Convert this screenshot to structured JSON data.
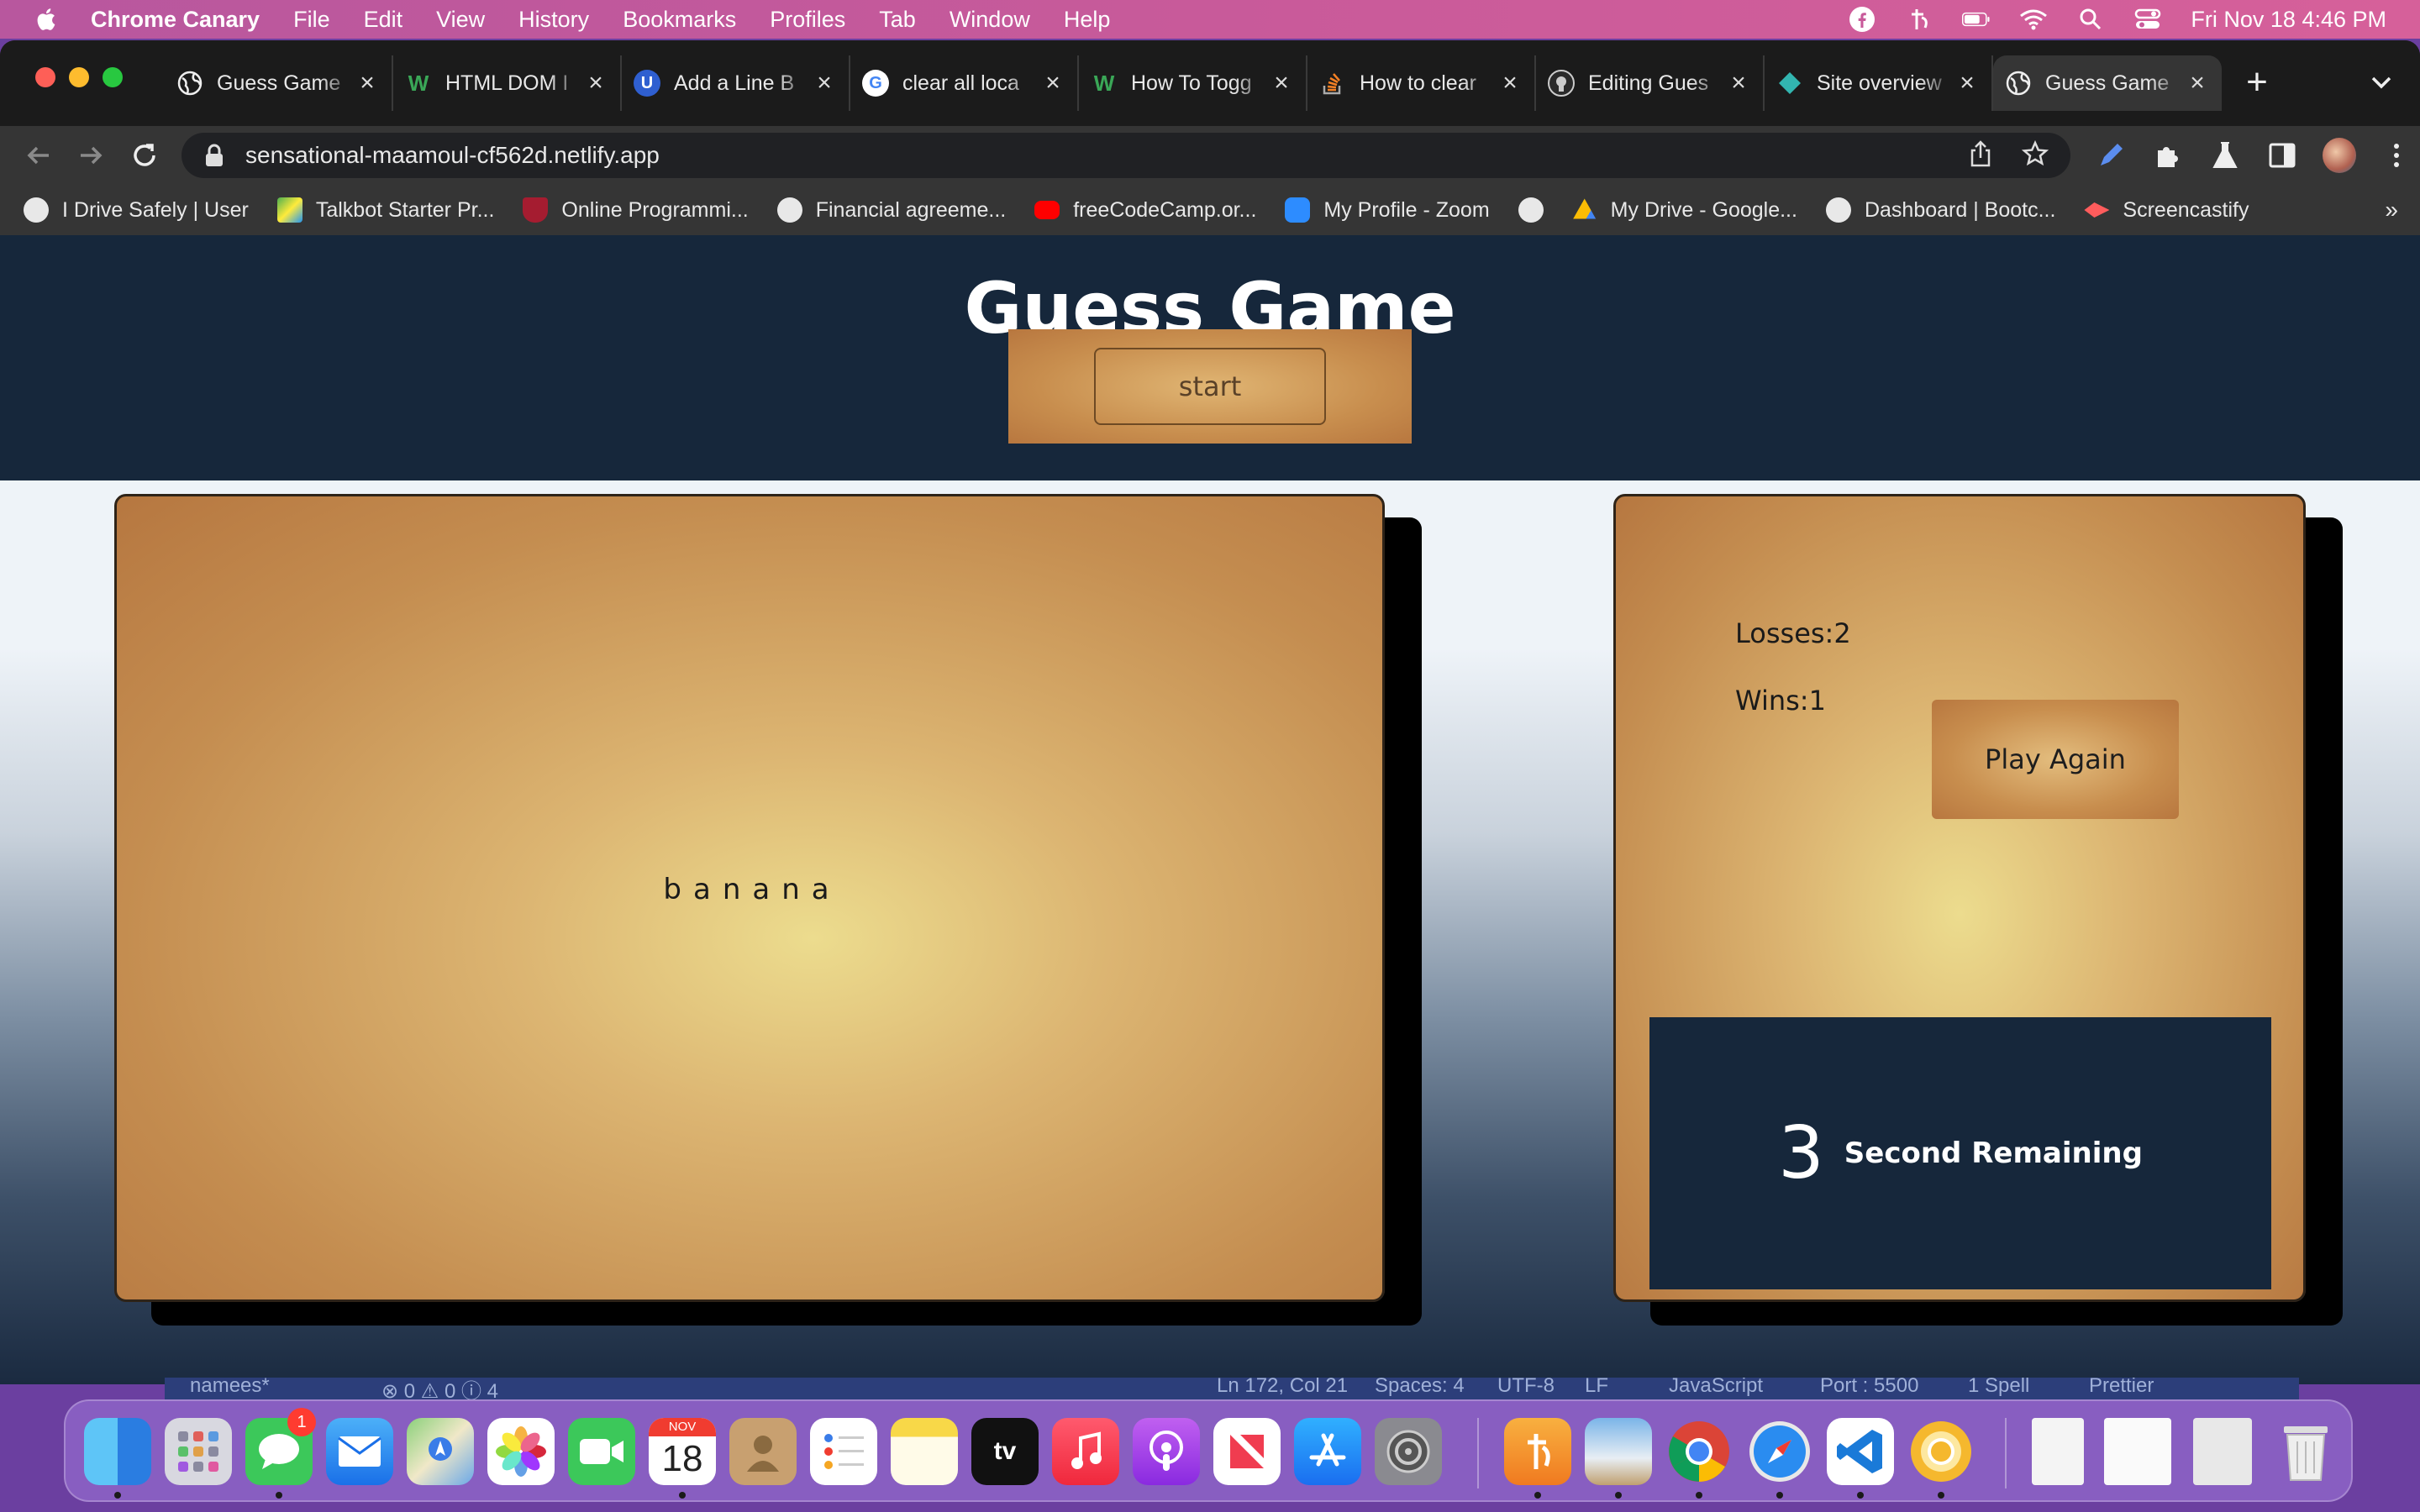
{
  "menubar": {
    "app_name": "Chrome Canary",
    "items": [
      "File",
      "Edit",
      "View",
      "History",
      "Bookmarks",
      "Profiles",
      "Tab",
      "Window",
      "Help"
    ],
    "clock": "Fri Nov 18  4:46 PM"
  },
  "browser": {
    "tabs": [
      {
        "title": "Guess Game",
        "icon": "globe-icon",
        "active": false
      },
      {
        "title": "HTML DOM I",
        "icon": "w3schools-icon",
        "active": false
      },
      {
        "title": "Add a Line B",
        "icon": "u-icon",
        "active": false
      },
      {
        "title": "clear all loca",
        "icon": "google-icon",
        "active": false
      },
      {
        "title": "How To Togg",
        "icon": "w3schools-icon",
        "active": false
      },
      {
        "title": "How to clear",
        "icon": "stackoverflow-icon",
        "active": false
      },
      {
        "title": "Editing Gues",
        "icon": "github-icon",
        "active": false
      },
      {
        "title": "Site overview",
        "icon": "netlify-icon",
        "active": false
      },
      {
        "title": "Guess Game",
        "icon": "globe-icon",
        "active": true
      }
    ],
    "new_tab": "+",
    "url": "sensational-maamoul-cf562d.netlify.app",
    "bookmarks": [
      {
        "label": "I Drive Safely | User",
        "icon": "globe-icon",
        "color": "#e8e8e8"
      },
      {
        "label": "Talkbot Starter Pr...",
        "icon": "talkbot-icon",
        "color": "#4caf50"
      },
      {
        "label": "Online Programmi...",
        "icon": "harvard-icon",
        "color": "#a51c30"
      },
      {
        "label": "Financial agreeme...",
        "icon": "globe-icon",
        "color": "#e8e8e8"
      },
      {
        "label": "freeCodeCamp.or...",
        "icon": "youtube-icon",
        "color": "#ff0000"
      },
      {
        "label": "My Profile - Zoom",
        "icon": "zoom-icon",
        "color": "#2d8cff"
      },
      {
        "label": "",
        "icon": "globe-icon",
        "color": "#e8e8e8"
      },
      {
        "label": "My Drive - Google...",
        "icon": "drive-icon",
        "color": "#fbbc04"
      },
      {
        "label": "Dashboard | Bootc...",
        "icon": "globe-icon",
        "color": "#e8e8e8"
      },
      {
        "label": "Screencastify",
        "icon": "screencastify-icon",
        "color": "#ff5c5c"
      }
    ],
    "bookmarks_more": "»"
  },
  "game": {
    "title": "Guess Game",
    "start_label": "start",
    "word": "banana",
    "losses_label": "Losses:2",
    "wins_label": "Wins:1",
    "play_again_label": "Play Again",
    "timer_value": "3",
    "timer_label": "Second Remaining"
  },
  "vscode_status": {
    "branch": "namees*",
    "problems": "⊗ 0 ⚠ 0 ⓘ 4",
    "position": "Ln 172, Col 21",
    "spaces": "Spaces: 4",
    "encoding": "UTF-8",
    "eol": "LF",
    "language": "JavaScript",
    "port": "Port : 5500",
    "spell": "1 Spell",
    "prettier": "Prettier"
  },
  "dock": {
    "calendar_month": "NOV",
    "calendar_day": "18",
    "messages_badge": "1",
    "tv_label": "tv",
    "icons": [
      "finder-icon",
      "launchpad-icon",
      "messages-icon",
      "mail-icon",
      "maps-icon",
      "photos-icon",
      "facetime-icon",
      "calendar-icon",
      "contacts-icon",
      "reminders-icon",
      "notes-icon",
      "appletv-icon",
      "music-icon",
      "podcasts-icon",
      "news-icon",
      "appstore-icon",
      "settings-icon",
      "typora-icon",
      "preview-icon",
      "chrome-icon",
      "safari-icon",
      "vscode-icon",
      "chrome-canary-icon",
      "document-icon",
      "screenshot-icon",
      "screenshot2-icon",
      "trash-icon"
    ]
  },
  "colors": {
    "header_navy": "#16273b",
    "card_gold": "#dcb572",
    "card_copper": "#b67740"
  }
}
